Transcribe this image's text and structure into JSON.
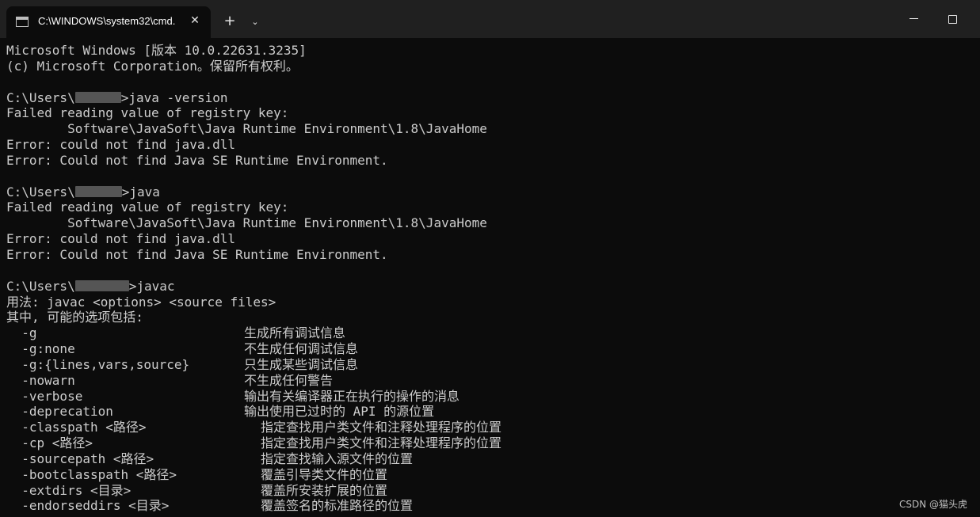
{
  "window": {
    "tab_title": "C:\\WINDOWS\\system32\\cmd.",
    "tab_close_glyph": "✕",
    "new_tab_glyph": "+",
    "dropdown_glyph": "⌄",
    "icon": "terminal-icon"
  },
  "console": {
    "header": {
      "line1": "Microsoft Windows [版本 10.0.22631.3235]",
      "line2": "(c) Microsoft Corporation。保留所有权利。"
    },
    "blocks": [
      {
        "prompt_prefix": "C:\\Users\\",
        "prompt_suffix": ">java -version",
        "out1": "Failed reading value of registry key:",
        "out2": "        Software\\JavaSoft\\Java Runtime Environment\\1.8\\JavaHome",
        "out3": "Error: could not find java.dll",
        "out4": "Error: Could not find Java SE Runtime Environment."
      },
      {
        "prompt_prefix": "C:\\Users\\",
        "prompt_suffix": ">java",
        "out1": "Failed reading value of registry key:",
        "out2": "        Software\\JavaSoft\\Java Runtime Environment\\1.8\\JavaHome",
        "out3": "Error: could not find java.dll",
        "out4": "Error: Could not find Java SE Runtime Environment."
      }
    ],
    "javac": {
      "prompt_prefix": "C:\\Users\\",
      "prompt_suffix": ">javac",
      "usage": "用法: javac <options> <source files>",
      "where": "其中, 可能的选项包括:",
      "options": [
        {
          "opt": "  -g",
          "desc": "生成所有调试信息"
        },
        {
          "opt": "  -g:none",
          "desc": "不生成任何调试信息"
        },
        {
          "opt": "  -g:{lines,vars,source}",
          "desc": "只生成某些调试信息"
        },
        {
          "opt": "  -nowarn",
          "desc": "不生成任何警告"
        },
        {
          "opt": "  -verbose",
          "desc": "输出有关编译器正在执行的操作的消息"
        },
        {
          "opt": "  -deprecation",
          "desc": "输出使用已过时的 API 的源位置"
        },
        {
          "opt": "  -classpath <路径>",
          "desc": "指定查找用户类文件和注释处理程序的位置"
        },
        {
          "opt": "  -cp <路径>",
          "desc": "指定查找用户类文件和注释处理程序的位置"
        },
        {
          "opt": "  -sourcepath <路径>",
          "desc": "指定查找输入源文件的位置"
        },
        {
          "opt": "  -bootclasspath <路径>",
          "desc": "覆盖引导类文件的位置"
        },
        {
          "opt": "  -extdirs <目录>",
          "desc": "覆盖所安装扩展的位置"
        },
        {
          "opt": "  -endorseddirs <目录>",
          "desc": "覆盖签名的标准路径的位置"
        }
      ]
    }
  },
  "watermark": "CSDN @猫头虎"
}
